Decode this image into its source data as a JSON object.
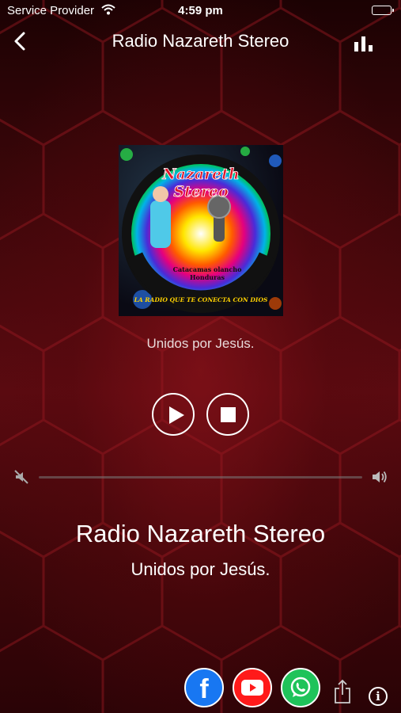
{
  "status_bar": {
    "carrier": "Service Provider",
    "time": "4:59 pm"
  },
  "nav": {
    "title": "Radio Nazareth Stereo",
    "back_icon": "chevron-left-icon",
    "equalizer_icon": "bar-chart-icon"
  },
  "artwork": {
    "logo_line1": "Nazareth",
    "logo_line2": "Stereo",
    "location_line1": "Catacamas olancho",
    "location_line2": "Honduras",
    "ring_text": "LA RADIO QUE TE CONECTA CON DIOS"
  },
  "now_playing": {
    "subtitle": "Unidos por Jesús."
  },
  "controls": {
    "play_icon": "play-icon",
    "stop_icon": "stop-icon"
  },
  "volume": {
    "level": 0.0,
    "mute_icon": "speaker-mute-icon",
    "loud_icon": "speaker-loud-icon"
  },
  "station": {
    "name": "Radio Nazareth Stereo",
    "slogan": "Unidos por Jesús."
  },
  "social": {
    "facebook_icon": "facebook-icon",
    "facebook_letter": "f",
    "youtube_icon": "youtube-icon",
    "whatsapp_icon": "whatsapp-icon",
    "share_icon": "share-icon",
    "info_icon": "info-icon",
    "info_letter": "i"
  },
  "colors": {
    "background": "#3a0508",
    "facebook": "#1877f2",
    "youtube": "#ff1a1a",
    "whatsapp": "#1fc35a"
  }
}
